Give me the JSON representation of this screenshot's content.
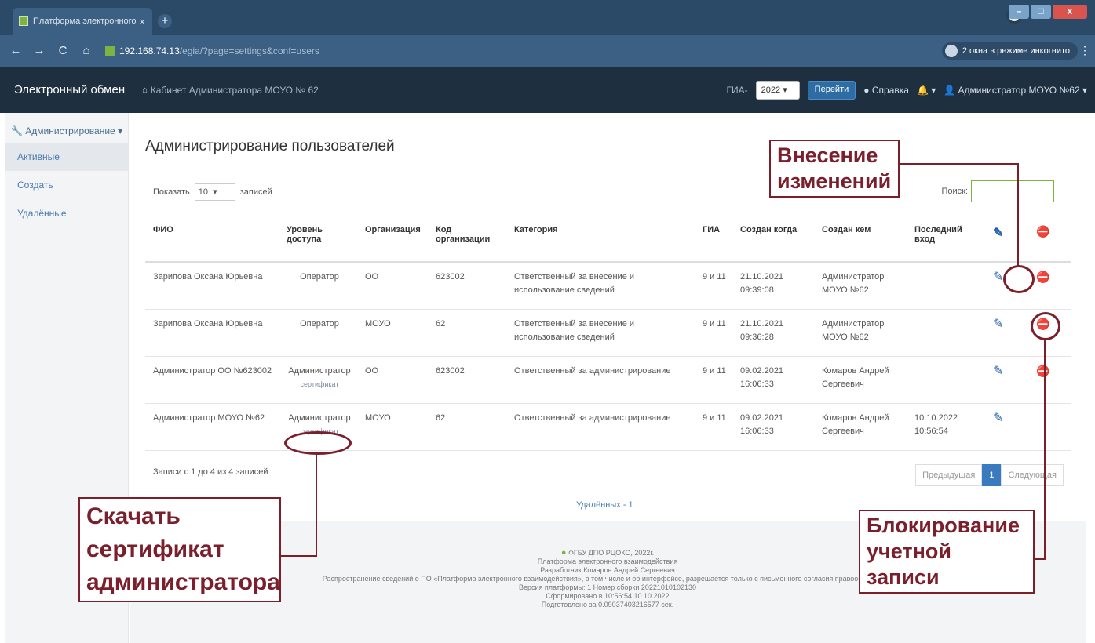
{
  "browser": {
    "tab_title": "Платформа электронного взаи",
    "tab_close": "×",
    "newtab": "+",
    "url_host": "192.168.74.13",
    "url_path": "/egia/?page=settings&conf=users",
    "incognito_label": "2 окна в режиме инкогнито",
    "window_controls": [
      "–",
      "□",
      "x"
    ]
  },
  "appnav": {
    "brand": "Электронный обмен",
    "cabinet": "Кабинет Администратора МОУО № 62",
    "gia_label": "ГИА-",
    "year": "2022",
    "go_button": "Перейти",
    "help": "Справка",
    "user": "Администратор МОУО №62"
  },
  "sidebar": {
    "section": "Администрирование",
    "items": [
      {
        "label": "Активные"
      },
      {
        "label": "Создать"
      },
      {
        "label": "Удалённые"
      }
    ]
  },
  "main": {
    "title": "Администрирование пользователей",
    "show_label": "Показать",
    "show_value": "10",
    "entries_label": "записей",
    "search_label": "Поиск:",
    "search_value": "",
    "columns": [
      "ФИО",
      "Уровень доступа",
      "Организация",
      "Код организации",
      "Категория",
      "ГИА",
      "Создан когда",
      "Создан кем",
      "Последний вход"
    ],
    "rows": [
      {
        "fio": "Зарипова Оксана Юрьевна",
        "level": "Оператор",
        "cert": "",
        "org": "ОО",
        "code": "623002",
        "category": "Ответственный за внесение и использование сведений",
        "gia": "9 и 11",
        "created": "21.10.2021 09:39:08",
        "created_by": "Администратор МОУО №62",
        "last_login": ""
      },
      {
        "fio": "Зарипова Оксана Юрьевна",
        "level": "Оператор",
        "cert": "",
        "org": "МОУО",
        "code": "62",
        "category": "Ответственный за внесение и использование сведений",
        "gia": "9 и 11",
        "created": "21.10.2021 09:36:28",
        "created_by": "Администратор МОУО №62",
        "last_login": ""
      },
      {
        "fio": "Администратор ОО №623002",
        "level": "Администратор",
        "cert": "сертификат",
        "org": "ОО",
        "code": "623002",
        "category": "Ответственный за администрирование",
        "gia": "9 и 11",
        "created": "09.02.2021 16:06:33",
        "created_by": "Комаров Андрей Сергеевич",
        "last_login": ""
      },
      {
        "fio": "Администратор МОУО №62",
        "level": "Администратор",
        "cert": "сертификат",
        "org": "МОУО",
        "code": "62",
        "category": "Ответственный за администрирование",
        "gia": "9 и 11",
        "created": "09.02.2021 16:06:33",
        "created_by": "Комаров Андрей Сергеевич",
        "last_login": "10.10.2022 10:56:54"
      }
    ],
    "info": "Записи с 1 до 4 из 4 записей",
    "prev": "Предыдущая",
    "page": "1",
    "next": "Следующая",
    "deleted": "Удалённых - 1"
  },
  "footer": {
    "line1": "ФГБУ ДПО РЦОКО, 2022г.",
    "line2": "Платформа электронного взаимодействия",
    "line3": "Разработчик Комаров Андрей Сергеевич",
    "line4": "Распространение сведений о ПО «Платформа электронного взаимодействия», в том числе и об интерфейсе, разрешается только с письменного согласия правообладателя",
    "line5": "Версия платформы: 1 Номер сборки 20221010102130",
    "line6": "Сформировано в 10:56:54 10.10.2022",
    "line7": "Подготовлено за 0.09037403216577 сек."
  },
  "callouts": {
    "edit": "Внесение изменений",
    "block": "Блокирование учетной записи",
    "download": "Скачать сертификат администратора"
  },
  "colors": {
    "accent": "#7a1f2b",
    "navbar": "#1e2f40",
    "link": "#1f5fa8",
    "active_page": "#3a7bbf"
  },
  "icons": [
    "pencil-icon",
    "block-user-icon",
    "home-icon",
    "wrench-icon",
    "bell-icon",
    "user-icon",
    "info-icon"
  ]
}
